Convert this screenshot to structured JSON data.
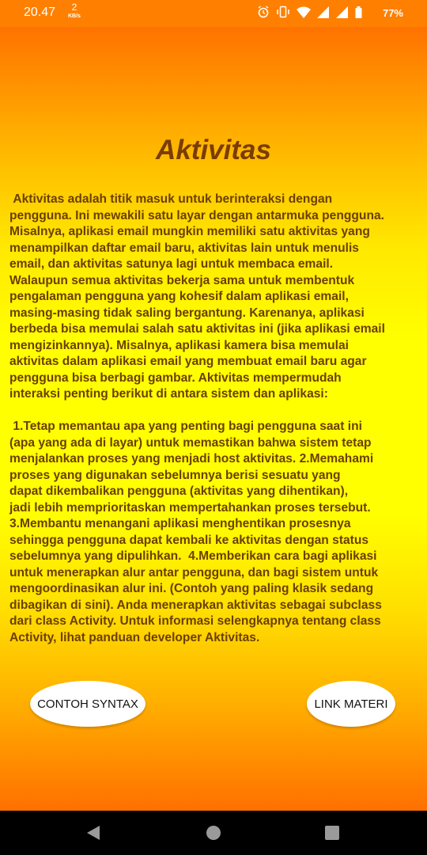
{
  "status_bar": {
    "time": "20.47",
    "net_speed": "2",
    "net_unit": "KB/s",
    "battery": "77%",
    "icons": [
      "alarm-icon",
      "vibrate-icon",
      "wifi-icon",
      "signal-icon",
      "signal-r-icon",
      "battery-icon"
    ]
  },
  "page": {
    "title": "Aktivitas",
    "body": " Aktivitas adalah titik masuk untuk berinteraksi dengan\npengguna. Ini mewakili satu layar dengan antarmuka pengguna.\nMisalnya, aplikasi email mungkin memiliki satu aktivitas yang\nmenampilkan daftar email baru, aktivitas lain untuk menulis\nemail, dan aktivitas satunya lagi untuk membaca email.\nWalaupun semua aktivitas bekerja sama untuk membentuk\npengalaman pengguna yang kohesif dalam aplikasi email,\nmasing-masing tidak saling bergantung. Karenanya, aplikasi\nberbeda bisa memulai salah satu aktivitas ini (jika aplikasi email\nmengizinkannya). Misalnya, aplikasi kamera bisa memulai\naktivitas dalam aplikasi email yang membuat email baru agar\npengguna bisa berbagi gambar. Aktivitas mempermudah\ninteraksi penting berikut di antara sistem dan aplikasi:\n\n 1.Tetap memantau apa yang penting bagi pengguna saat ini\n(apa yang ada di layar) untuk memastikan bahwa sistem tetap\nmenjalankan proses yang menjadi host aktivitas. 2.Memahami\nproses yang digunakan sebelumnya berisi sesuatu yang\ndapat dikembalikan pengguna (aktivitas yang dihentikan),\njadi lebih memprioritaskan mempertahankan proses tersebut.\n3.Membantu menangani aplikasi menghentikan prosesnya\nsehingga pengguna dapat kembali ke aktivitas dengan status\nsebelumnya yang dipulihkan.  4.Memberikan cara bagi aplikasi\nuntuk menerapkan alur antar pengguna, dan bagi sistem untuk\nmengoordinasikan alur ini. (Contoh yang paling klasik sedang\ndibagikan di sini). Anda menerapkan aktivitas sebagai subclass\ndari class Activity. Untuk informasi selengkapnya tentang class\nActivity, lihat panduan developer Aktivitas."
  },
  "buttons": {
    "syntax": "CONTOH SYNTAX",
    "link": "LINK MATERI"
  },
  "nav": {
    "icons": [
      "back-icon",
      "home-icon",
      "recents-icon"
    ]
  },
  "colors": {
    "status_bar": "#ff8000",
    "title": "#7a3c00",
    "text": "#6b3f00",
    "gradient_top": "#ff7200",
    "gradient_mid": "#ffff00",
    "nav_bar": "#000000"
  }
}
